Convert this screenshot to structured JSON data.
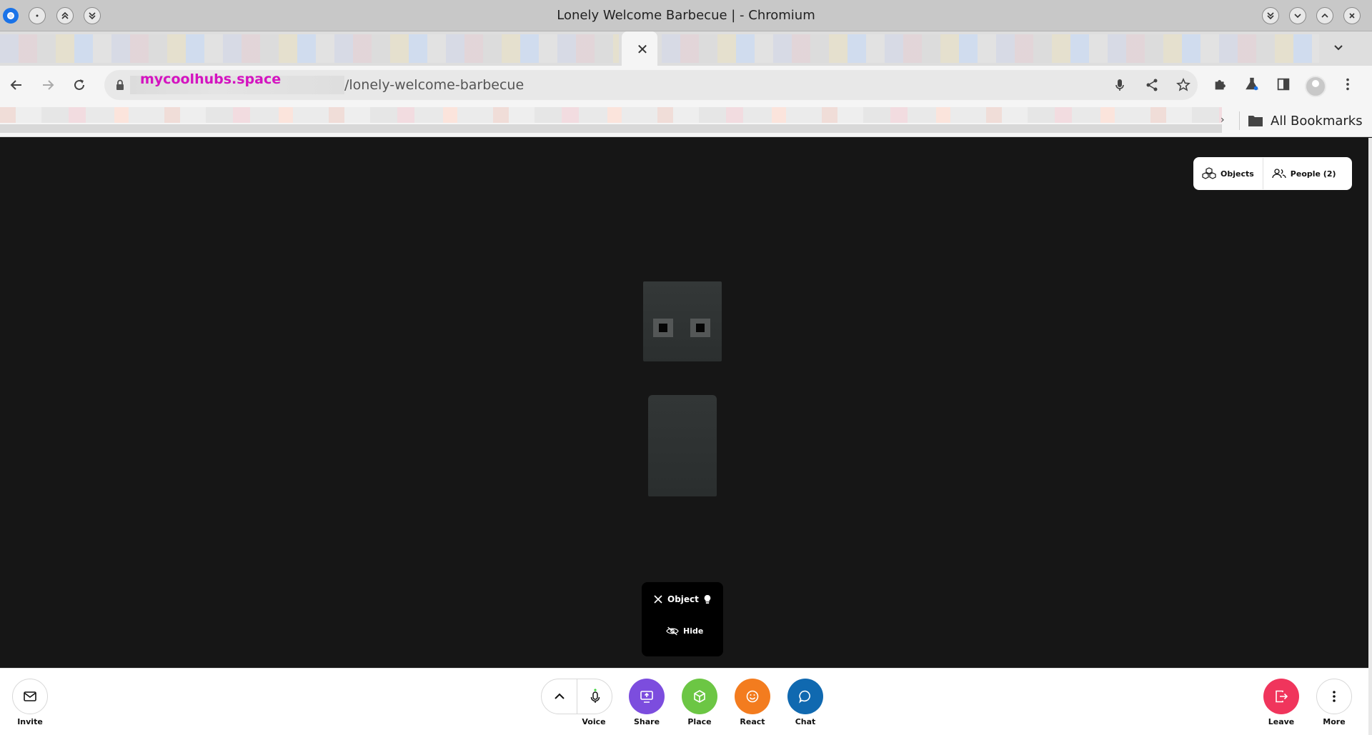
{
  "window": {
    "title": "Lonely Welcome Barbecue | - Chromium"
  },
  "tabs": {
    "close_symbol": "✕"
  },
  "address_bar": {
    "host": "mycoolhubs.space",
    "path": "/lonely-welcome-barbecue"
  },
  "bookmarks_bar": {
    "overflow_symbol": "›",
    "all_bookmarks_label": "All Bookmarks"
  },
  "scene_panel": {
    "objects_label": "Objects",
    "people_label": "People (2)"
  },
  "object_menu": {
    "title": "Object",
    "hide_label": "Hide"
  },
  "bottom_toolbar": {
    "invite_label": "Invite",
    "voice_label": "Voice",
    "share_label": "Share",
    "place_label": "Place",
    "react_label": "React",
    "chat_label": "Chat",
    "leave_label": "Leave",
    "more_label": "More"
  },
  "colors": {
    "share": "#7c4dde",
    "place": "#6cc644",
    "react": "#f37c1f",
    "chat": "#1069b0",
    "leave": "#f0355c",
    "host_text": "#d414c0",
    "mic_indicator": "#3fd43f"
  }
}
